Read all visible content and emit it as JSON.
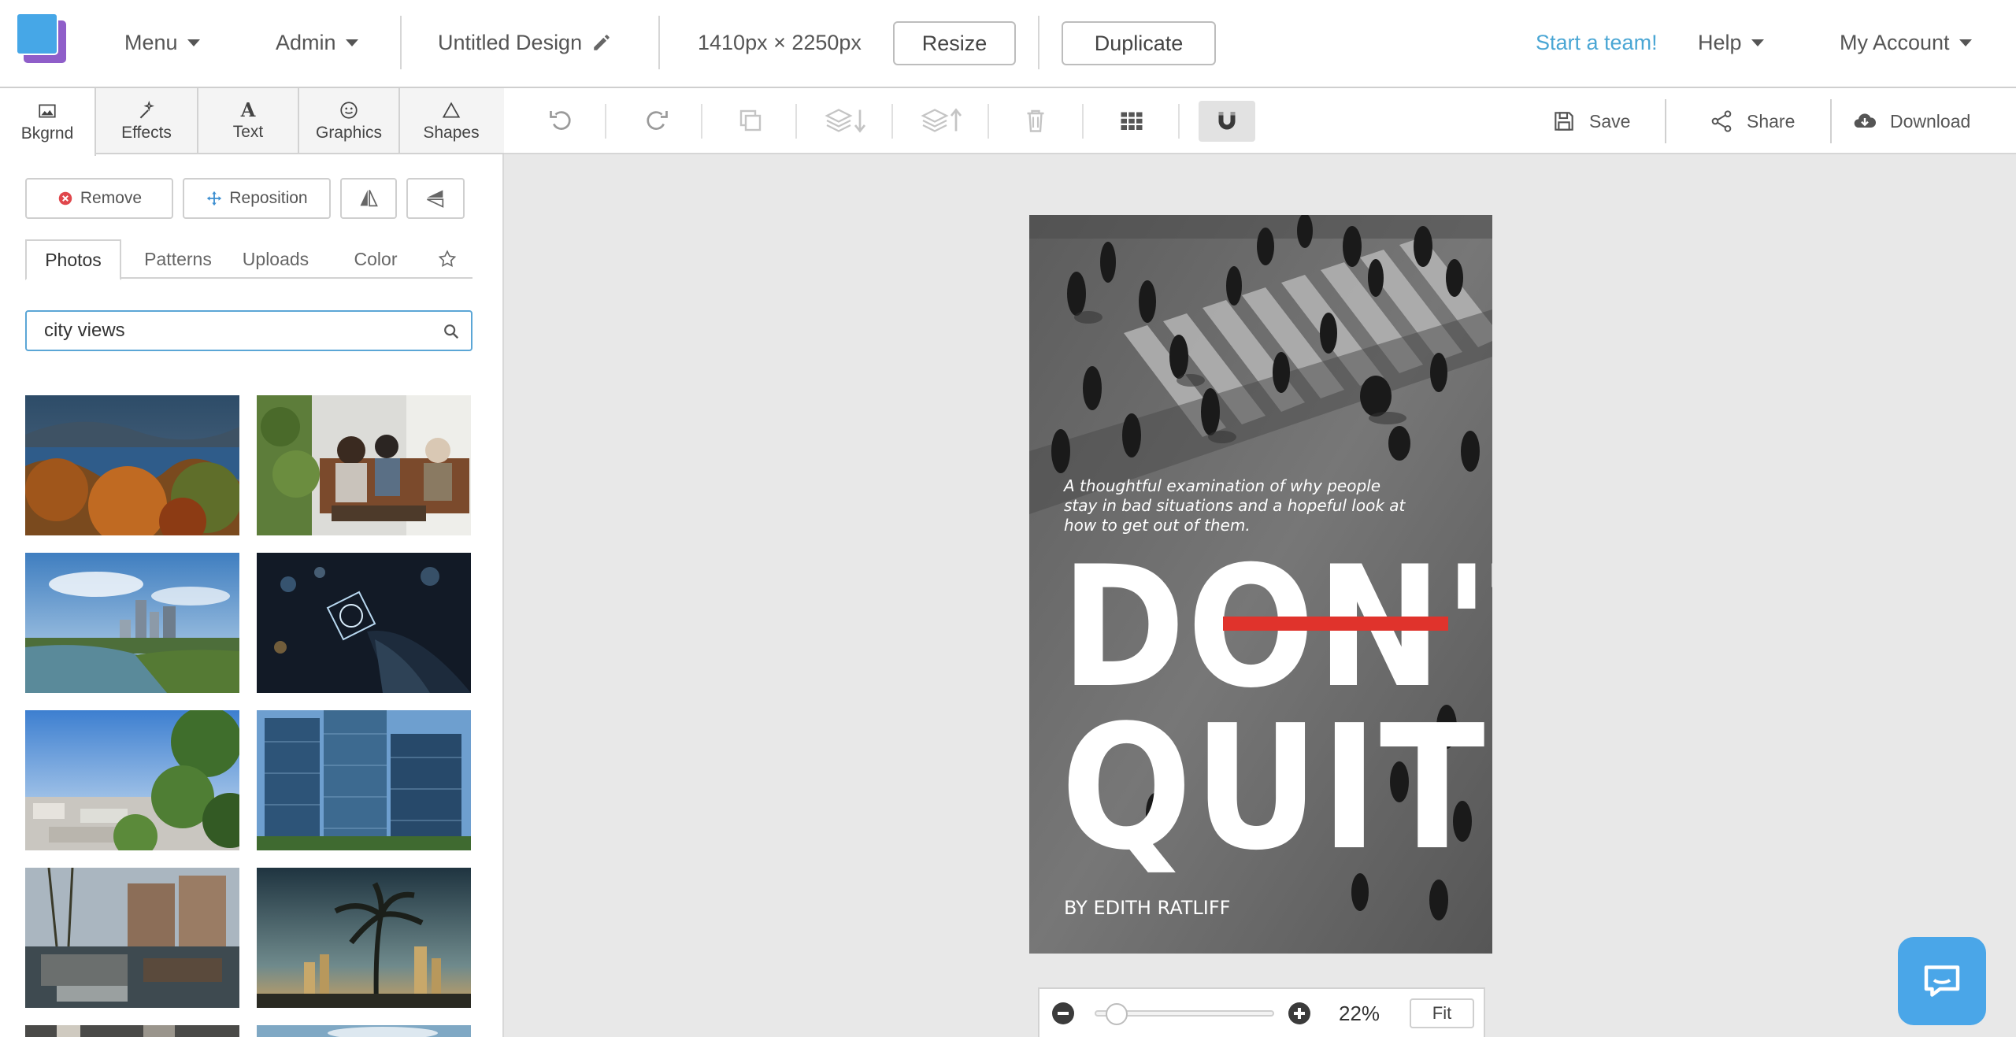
{
  "header": {
    "menu_label": "Menu",
    "admin_label": "Admin",
    "design_title": "Untitled Design",
    "dimensions": "1410px × 2250px",
    "resize_label": "Resize",
    "duplicate_label": "Duplicate",
    "start_team_label": "Start a team!",
    "help_label": "Help",
    "account_label": "My Account"
  },
  "tools": [
    {
      "label": "Bkgrnd",
      "icon": "image-icon"
    },
    {
      "label": "Effects",
      "icon": "magic-wand-icon"
    },
    {
      "label": "Text",
      "icon": "text-icon"
    },
    {
      "label": "Graphics",
      "icon": "smiley-icon"
    },
    {
      "label": "Shapes",
      "icon": "triangle-icon"
    }
  ],
  "background_actions": {
    "remove_label": "Remove",
    "reposition_label": "Reposition"
  },
  "subtabs": [
    "Photos",
    "Patterns",
    "Uploads",
    "Color"
  ],
  "search": {
    "value": "city views"
  },
  "toolbar": {
    "save_label": "Save",
    "share_label": "Share",
    "download_label": "Download"
  },
  "design": {
    "tagline": "A thoughtful examination of why people stay in bad situations and a hopeful look at how to get out of them.",
    "line1": "DON'T",
    "line2": "QUIT",
    "author": "BY EDITH RATLIFF"
  },
  "zoom": {
    "value": "22%",
    "level": 0.06,
    "fit_label": "Fit"
  },
  "colors": {
    "accent_blue": "#4aa6d4",
    "strike_red": "#e0332c",
    "chat_blue": "#4aa6e8"
  }
}
